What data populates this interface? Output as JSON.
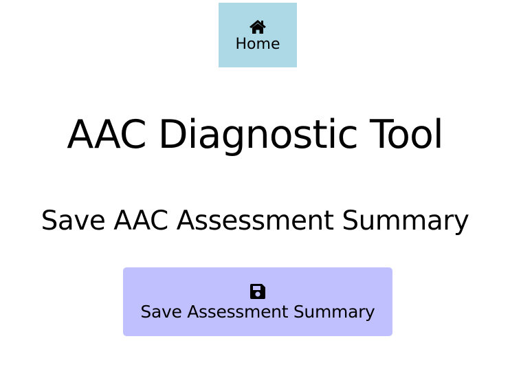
{
  "nav": {
    "home_icon": "home-icon",
    "home_label": "Home",
    "home_bg": "#add8e6"
  },
  "header": {
    "title": "AAC Diagnostic Tool"
  },
  "main": {
    "section_title": "Save AAC Assessment Summary",
    "save_icon": "floppy-disk-icon",
    "save_label": "Save Assessment Summary",
    "save_bg": "#c0c0ff"
  }
}
